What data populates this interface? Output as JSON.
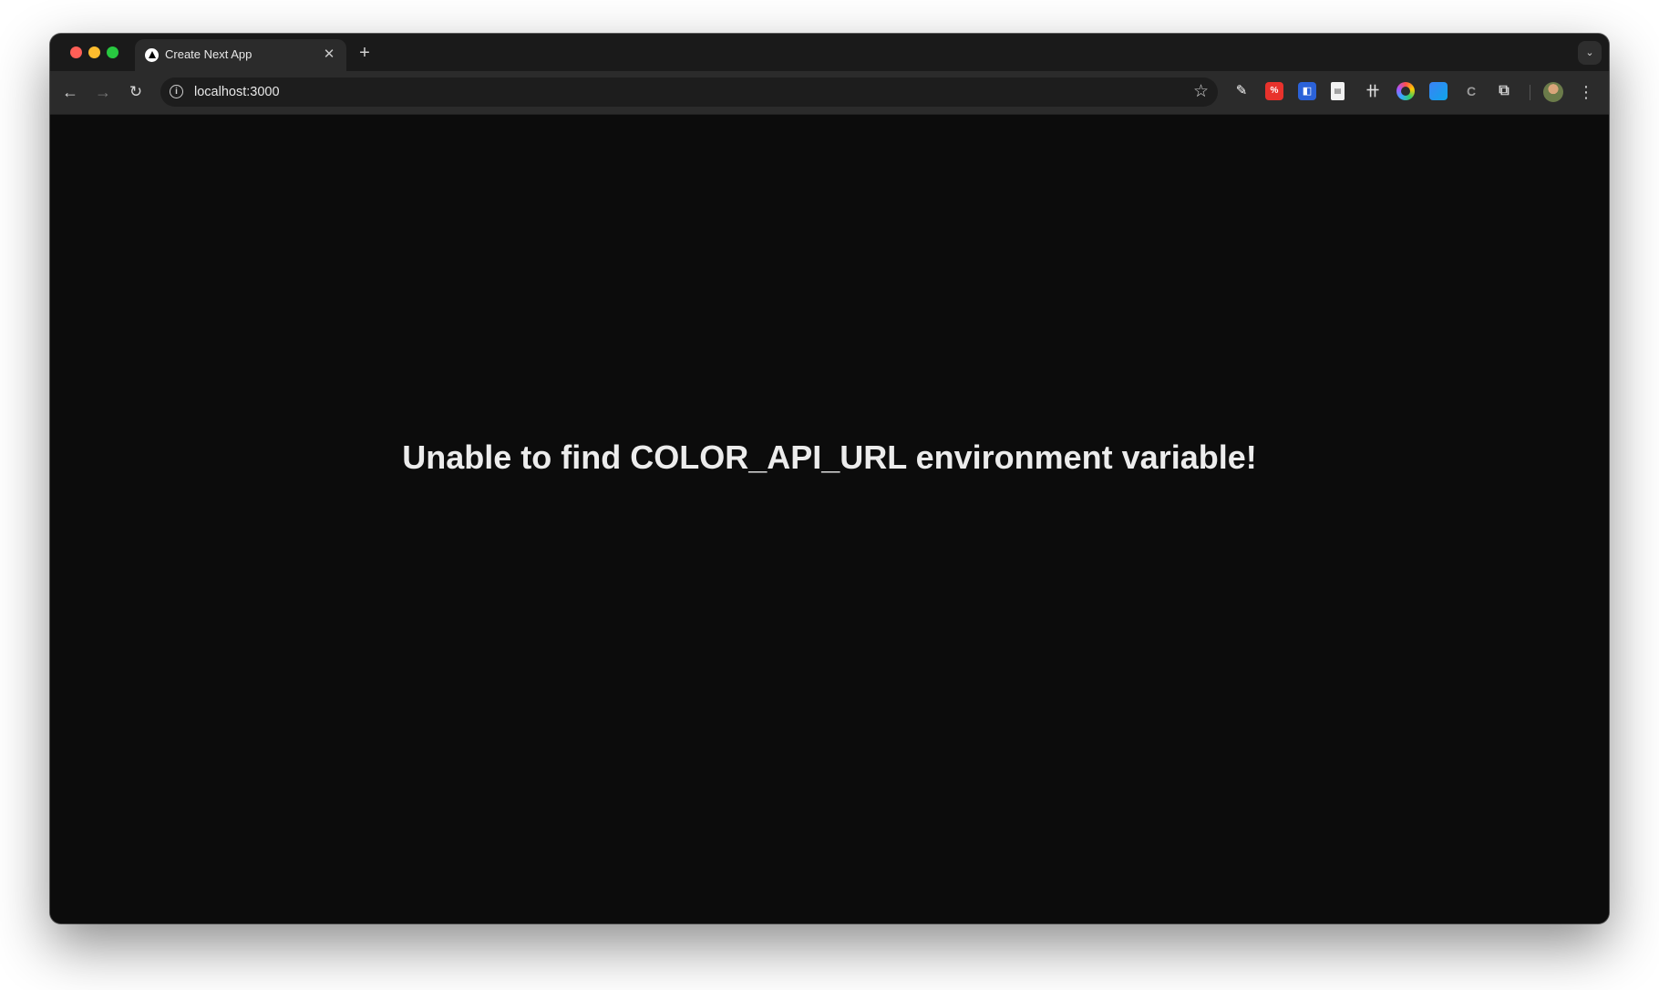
{
  "browser": {
    "tab": {
      "title": "Create Next App",
      "close_glyph": "✕",
      "favicon": "nextjs-triangle-icon"
    },
    "new_tab_glyph": "+",
    "tab_search_glyph": "⌄",
    "toolbar": {
      "back_glyph": "←",
      "forward_glyph": "→",
      "reload_glyph": "↻",
      "url": "localhost:3000",
      "info_glyph": "i",
      "star_glyph": "☆",
      "menu_glyph": "⋮"
    },
    "extensions": [
      {
        "name": "eyedropper-icon",
        "glyph": "✎"
      },
      {
        "name": "translate-extension-icon",
        "glyph": "%"
      },
      {
        "name": "password-manager-icon",
        "glyph": "◧"
      },
      {
        "name": "document-extension-icon",
        "glyph": "▤"
      },
      {
        "name": "web-developer-icon",
        "glyph": "卄"
      },
      {
        "name": "color-wheel-icon",
        "glyph": ""
      },
      {
        "name": "image-extension-icon",
        "glyph": ""
      },
      {
        "name": "code-extension-icon",
        "glyph": "C"
      },
      {
        "name": "extensions-puzzle-icon",
        "glyph": "⧉"
      }
    ]
  },
  "page": {
    "message": "Unable to find COLOR_API_URL environment variable!"
  },
  "colors": {
    "page_background": "#0c0c0c",
    "toolbar_background": "#2b2b2b",
    "tabstrip_background": "#1a1a1a",
    "text": "#ececec"
  }
}
